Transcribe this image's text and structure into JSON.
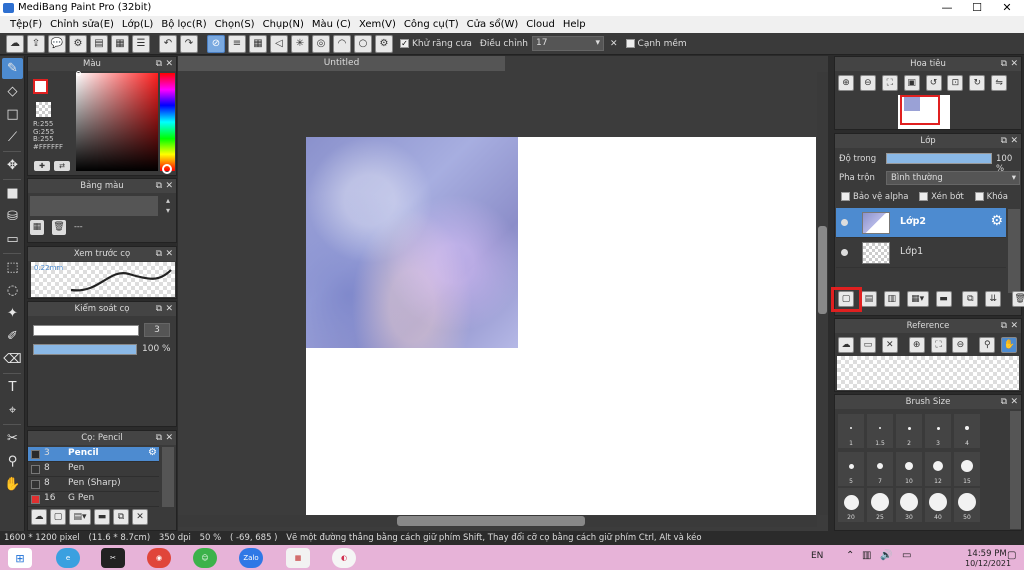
{
  "window": {
    "title": "MediBang Paint Pro (32bit)",
    "min": "—",
    "max": "☐",
    "close": "✕"
  },
  "menu": [
    "Tệp(F)",
    "Chỉnh sửa(E)",
    "Lớp(L)",
    "Bộ lọc(R)",
    "Chọn(S)",
    "Chụp(N)",
    "Màu (C)",
    "Xem(V)",
    "Công cụ(T)",
    "Cửa sổ(W)",
    "Cloud",
    "Help"
  ],
  "toolbar": {
    "antialias_label": "Khử răng cưa",
    "adjust_label": "Điều chỉnh",
    "adjust_value": "17",
    "edge_label": "Cạnh mềm"
  },
  "color_panel": {
    "title": "Màu",
    "r": "R:255",
    "g": "G:255",
    "b": "B:255",
    "hex": "#FFFFFF"
  },
  "palette_panel": {
    "title": "Bảng màu",
    "dash": "---"
  },
  "preview_panel": {
    "title": "Xem trước cọ",
    "size": "0.22mm"
  },
  "brush_control": {
    "title": "Kiểm soát cọ",
    "size": "3",
    "opacity": "100 %",
    "opacity_fraction": 1.0,
    "size_fraction": 0.98
  },
  "brush_panel": {
    "title": "Cọ: Pencil",
    "items": [
      {
        "num": "3",
        "name": "Pencil",
        "color": "#2a2a2a",
        "selected": true
      },
      {
        "num": "8",
        "name": "Pen",
        "color": "#333333",
        "selected": false
      },
      {
        "num": "8",
        "name": "Pen (Sharp)",
        "color": "#333333",
        "selected": false
      },
      {
        "num": "16",
        "name": "G Pen",
        "color": "#e03030",
        "selected": false
      }
    ]
  },
  "document": {
    "tab": "Untitled"
  },
  "navigator": {
    "title": "Hoa tiêu"
  },
  "layers": {
    "title": "Lớp",
    "opacity_label": "Độ trong",
    "opacity_value": "100 %",
    "blend_label": "Pha trộn",
    "blend_value": "Bình thường",
    "protect_alpha": "Bảo vệ alpha",
    "clipping": "Xén bớt",
    "lock": "Khóa",
    "items": [
      {
        "name": "Lớp2",
        "selected": true
      },
      {
        "name": "Lớp1",
        "selected": false
      }
    ]
  },
  "reference": {
    "title": "Reference"
  },
  "brush_size": {
    "title": "Brush Size",
    "rows": [
      [
        "1",
        "1.5",
        "2",
        "3",
        "4"
      ],
      [
        "5",
        "7",
        "10",
        "12",
        "15"
      ],
      [
        "20",
        "25",
        "30",
        "40",
        "50"
      ]
    ]
  },
  "status": {
    "size": "1600 * 1200 pixel",
    "physical": "(11.6 * 8.7cm)",
    "dpi": "350 dpi",
    "zoom": "50 %",
    "coords": "( -69, 685 )",
    "hint": "Vẽ một đường thẳng bằng cách giữ phím Shift, Thay đổi cỡ cọ bằng cách giữ phím Ctrl, Alt và kéo"
  },
  "taskbar": {
    "lang": "EN",
    "time": "14:59 PM",
    "date": "10/12/2021",
    "zalo": "Zalo"
  },
  "colors": {
    "accent": "#4d8bd0",
    "highlight_box": "#e02020",
    "taskbar": "#e7b3d8"
  }
}
